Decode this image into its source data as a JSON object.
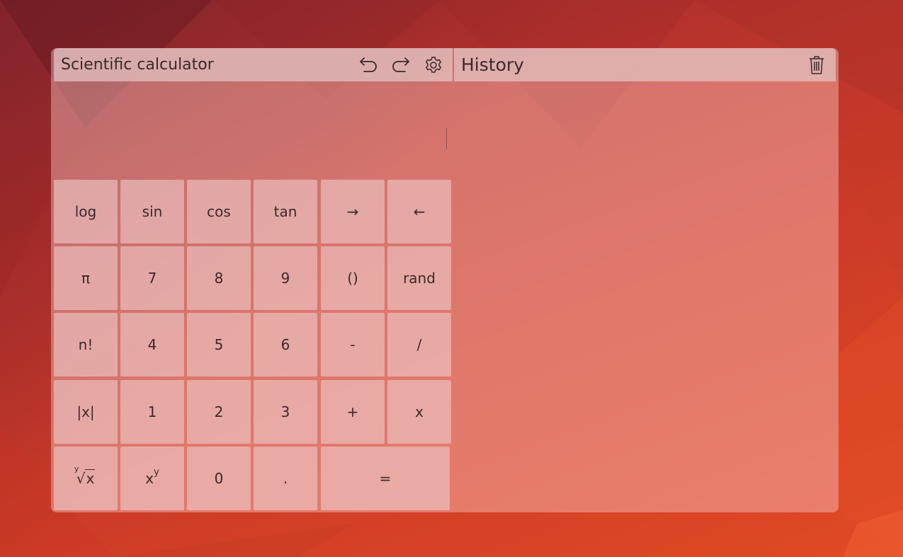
{
  "header": {
    "title": "Scientific calculator"
  },
  "history": {
    "title": "History"
  },
  "display": {
    "expression": ""
  },
  "keys": [
    {
      "id": "log",
      "label": "log"
    },
    {
      "id": "sin",
      "label": "sin"
    },
    {
      "id": "cos",
      "label": "cos"
    },
    {
      "id": "tan",
      "label": "tan"
    },
    {
      "id": "right-arrow",
      "label": "→"
    },
    {
      "id": "left-arrow",
      "label": "←"
    },
    {
      "id": "pi",
      "label": "π"
    },
    {
      "id": "7",
      "label": "7"
    },
    {
      "id": "8",
      "label": "8"
    },
    {
      "id": "9",
      "label": "9"
    },
    {
      "id": "parentheses",
      "label": "()"
    },
    {
      "id": "rand",
      "label": "rand"
    },
    {
      "id": "factorial",
      "label": "n!"
    },
    {
      "id": "4",
      "label": "4"
    },
    {
      "id": "5",
      "label": "5"
    },
    {
      "id": "6",
      "label": "6"
    },
    {
      "id": "minus",
      "label": "-"
    },
    {
      "id": "divide",
      "label": "/"
    },
    {
      "id": "abs",
      "label": "|x|"
    },
    {
      "id": "1",
      "label": "1"
    },
    {
      "id": "2",
      "label": "2"
    },
    {
      "id": "3",
      "label": "3"
    },
    {
      "id": "plus",
      "label": "+"
    },
    {
      "id": "multiply",
      "label": "x"
    },
    {
      "id": "root",
      "label": "",
      "root_index": "y",
      "root_radicand": "x"
    },
    {
      "id": "power",
      "label": "",
      "pow_base": "x",
      "pow_exp": "y"
    },
    {
      "id": "0",
      "label": "0"
    },
    {
      "id": "decimal",
      "label": "."
    },
    {
      "id": "equals",
      "label": "="
    }
  ],
  "icons": {
    "undo": "undo-icon",
    "redo": "redo-icon",
    "settings": "gear-icon",
    "clear_history": "trash-icon"
  },
  "colors": {
    "text": "#3a2a2a",
    "header_bg": "#e1bebe",
    "key_bg": "#eec8c8"
  }
}
